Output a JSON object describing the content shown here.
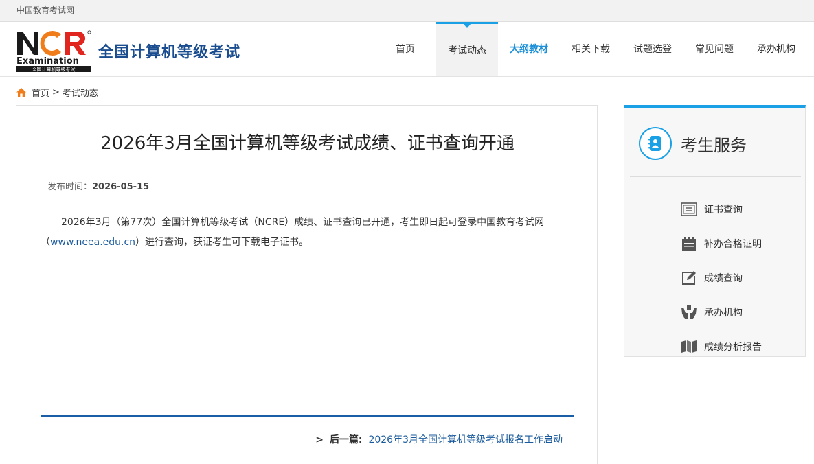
{
  "topbar": {
    "site_link": "中国教育考试网"
  },
  "header": {
    "logo_text": "NCR Examination 全国计算机等级考试",
    "site_title": "全国计算机等级考试"
  },
  "nav": {
    "items": [
      {
        "label": "首页"
      },
      {
        "label": "考试动态"
      },
      {
        "label": "大纲教材"
      },
      {
        "label": "相关下载"
      },
      {
        "label": "试题选登"
      },
      {
        "label": "常见问题"
      },
      {
        "label": "承办机构"
      }
    ]
  },
  "breadcrumb": {
    "home": "首页",
    "separator": ">",
    "current": "考试动态"
  },
  "article": {
    "title": "2026年3月全国计算机等级考试成绩、证书查询开通",
    "published_label": "发布时间：",
    "published_date": "2026-05-15",
    "body_part1": "2026年3月（第77次）全国计算机等级考试（NCRE）成绩、证书查询已开通，考生即日起可登录中国教育考试网（",
    "body_link": "www.neea.edu.cn",
    "body_part2": "）进行查询，获证考生可下载电子证书。",
    "next_marker": ">",
    "next_label": "后一篇:",
    "next_title": "2026年3月全国计算机等级考试报名工作启动"
  },
  "sidebar": {
    "title": "考生服务",
    "items": [
      {
        "label": "证书查询",
        "icon": "certificate-icon"
      },
      {
        "label": "补办合格证明",
        "icon": "calendar-icon"
      },
      {
        "label": "成绩查询",
        "icon": "edit-icon"
      },
      {
        "label": "承办机构",
        "icon": "hands-icon"
      },
      {
        "label": "成绩分析报告",
        "icon": "map-icon"
      }
    ]
  },
  "colors": {
    "accent": "#1aa0e4",
    "brand": "#1a4d8f",
    "link": "#1a5a9c",
    "logo_orange": "#f07c1a"
  }
}
